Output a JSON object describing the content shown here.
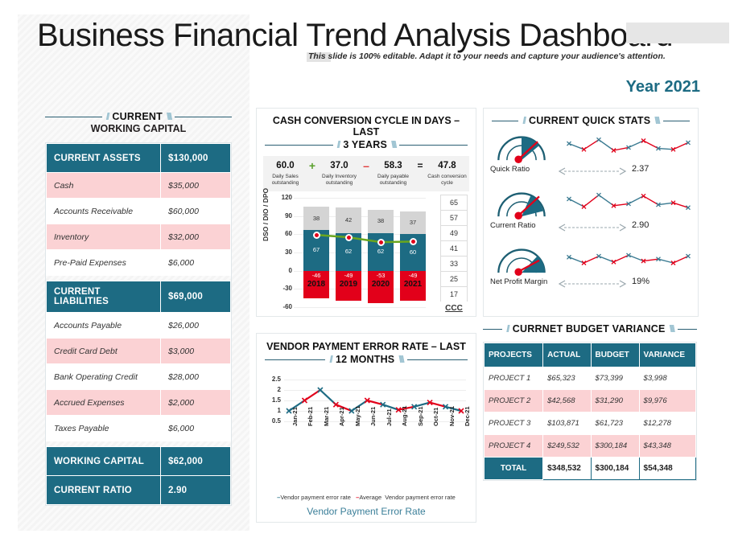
{
  "header": {
    "title": "Business Financial Trend Analysis Dashboard",
    "subtitle": "This slide is 100% editable. Adapt it to your needs and capture your audience's attention.",
    "year_label": "Year",
    "year_value": "2021"
  },
  "colors": {
    "teal": "#1d6b83",
    "pink": "#fbd2d4",
    "red": "#e2001a",
    "gray_bar": "#d4d4d4",
    "green_line": "#6aa61e",
    "accent_text": "#3b7f99"
  },
  "working_capital": {
    "head_line1": "CURRENT",
    "head_line2": "WORKING CAPITAL",
    "assets_header": {
      "label": "CURRENT ASSETS",
      "value": "$130,000"
    },
    "assets_rows": [
      {
        "label": "Cash",
        "value": "$35,000"
      },
      {
        "label": "Accounts Receivable",
        "value": "$60,000"
      },
      {
        "label": "Inventory",
        "value": "$32,000"
      },
      {
        "label": "Pre-Paid Expenses",
        "value": "$6,000"
      }
    ],
    "liabilities_header": {
      "label": "CURRENT LIABILITIES",
      "value": "$69,000"
    },
    "liabilities_rows": [
      {
        "label": "Accounts Payable",
        "value": "$26,000"
      },
      {
        "label": "Credit Card Debt",
        "value": "$3,000"
      },
      {
        "label": "Bank Operating Credit",
        "value": "$28,000"
      },
      {
        "label": "Accrued Expenses",
        "value": "$2,000"
      },
      {
        "label": "Taxes Payable",
        "value": "$6,000"
      }
    ],
    "totals": [
      {
        "label": "WORKING CAPITAL",
        "value": "$62,000"
      },
      {
        "label": "CURRENT RATIO",
        "value": "2.90"
      }
    ]
  },
  "ccc": {
    "head_line1": "CASH CONVERSION CYCLE IN DAYS – LAST",
    "head_line2": "3 YEARS",
    "kpis": [
      {
        "num": "60.0",
        "caption": "Daily Sales outstanding"
      },
      {
        "num": "37.0",
        "caption": "Daily Inventory outstanding"
      },
      {
        "num": "58.3",
        "caption": "Daily payable outstanding"
      },
      {
        "num": "47.8",
        "caption": "Cash conversion cycle"
      }
    ],
    "operators": [
      "+",
      "–",
      "="
    ],
    "right_axis_caption": "CCC"
  },
  "chart_data": [
    {
      "type": "bar",
      "title": "CASH CONVERSION CYCLE IN DAYS – LAST 3 YEARS",
      "xlabel": "",
      "ylabel": "DSO / DIO / DPO",
      "categories": [
        "2018",
        "2019",
        "2020",
        "2021"
      ],
      "ylim": [
        -60,
        120
      ],
      "yticks": [
        120,
        90,
        60,
        30,
        0,
        -30,
        -60
      ],
      "grid": true,
      "stacked": true,
      "series": [
        {
          "name": "DSO",
          "values": [
            67,
            62,
            62,
            60
          ],
          "color": "#1d6b83"
        },
        {
          "name": "DIO",
          "values": [
            38,
            42,
            38,
            37
          ],
          "color": "#d4d4d4"
        },
        {
          "name": "DPO",
          "values": [
            -46,
            -49,
            -53,
            -49
          ],
          "color": "#e2001a"
        }
      ],
      "overlay_line": {
        "name": "CCC",
        "values": [
          59,
          55,
          47,
          48
        ],
        "color": "#6aa61e",
        "marker_color": "#e2001a",
        "secondary_axis": {
          "caption": "CCC",
          "ticks": [
            65,
            57,
            49,
            41,
            33,
            25,
            17
          ]
        }
      }
    },
    {
      "type": "line",
      "title": "VENDOR PAYMENT ERROR RATE – LAST 12 MONTHS",
      "xlabel": "Vendor Payment Error Rate",
      "ylabel": "",
      "ylim": [
        0.5,
        2.5
      ],
      "yticks": [
        2.5,
        2,
        1.5,
        1,
        0.5
      ],
      "grid": true,
      "categories": [
        "Jan-21",
        "Feb-21",
        "Mar-21",
        "Apr-21",
        "May-21",
        "Jun-21",
        "Jul-21",
        "Aug-21",
        "Sep-21",
        "Oct-21",
        "Nov-21",
        "Dec-21"
      ],
      "series": [
        {
          "name": "Vendor payment error rate",
          "values": [
            1.0,
            1.5,
            2.0,
            1.3,
            1.0,
            1.5,
            1.3,
            1.05,
            1.2,
            1.4,
            1.2,
            1.0
          ],
          "color": "#1d6b83"
        }
      ],
      "legend": [
        {
          "label": "Vendor payment error rate",
          "color": "#1d6b83"
        },
        {
          "label": "Average Vendor payment error rate",
          "color": "#e2001a"
        }
      ],
      "legend_position": "bottom"
    },
    {
      "type": "line",
      "title": "Quick Ratio sparkline",
      "values": [
        1.2,
        0.6,
        1.6,
        0.5,
        0.8,
        1.5,
        0.7,
        0.6,
        1.3
      ],
      "ylim": [
        0,
        2
      ]
    },
    {
      "type": "line",
      "title": "Current Ratio sparkline",
      "values": [
        1.3,
        0.5,
        1.7,
        0.6,
        0.8,
        1.6,
        0.7,
        0.9,
        0.4
      ],
      "ylim": [
        0,
        2
      ]
    },
    {
      "type": "line",
      "title": "Net Profit Margin sparkline",
      "values": [
        1.1,
        0.5,
        1.2,
        0.6,
        1.3,
        0.7,
        0.9,
        0.5,
        1.2
      ],
      "ylim": [
        0,
        2
      ]
    }
  ],
  "vendor": {
    "head_line1": "VENDOR PAYMENT ERROR RATE – LAST",
    "head_line2": "12 MONTHS",
    "legend_1": "Vendor payment error rate",
    "legend_2": "Average",
    "legend_3": "Vendor payment error rate",
    "x_title": "Vendor Payment Error Rate"
  },
  "quick_stats": {
    "head": "CURRENT QUICK STATS",
    "rows": [
      {
        "name": "Quick Ratio",
        "value": "2.37"
      },
      {
        "name": "Current Ratio",
        "value": "2.90"
      },
      {
        "name": "Net Profit Margin",
        "value": "19%"
      }
    ]
  },
  "budget_variance": {
    "head": "CURRNET BUDGET VARIANCE",
    "columns": [
      "PROJECTS",
      "ACTUAL",
      "BUDGET",
      "VARIANCE"
    ],
    "rows": [
      {
        "project": "PROJECT 1",
        "actual": "$65,323",
        "budget": "$73,399",
        "variance": "$3,998"
      },
      {
        "project": "PROJECT 2",
        "actual": "$42,568",
        "budget": "$31,290",
        "variance": "$9,976"
      },
      {
        "project": "PROJECT 3",
        "actual": "$103,871",
        "budget": "$61,723",
        "variance": "$12,278"
      },
      {
        "project": "PROJECT 4",
        "actual": "$249,532",
        "budget": "$300,184",
        "variance": "$43,348"
      }
    ],
    "total": {
      "project": "TOTAL",
      "actual": "$348,532",
      "budget": "$300,184",
      "variance": "$54,348"
    }
  }
}
